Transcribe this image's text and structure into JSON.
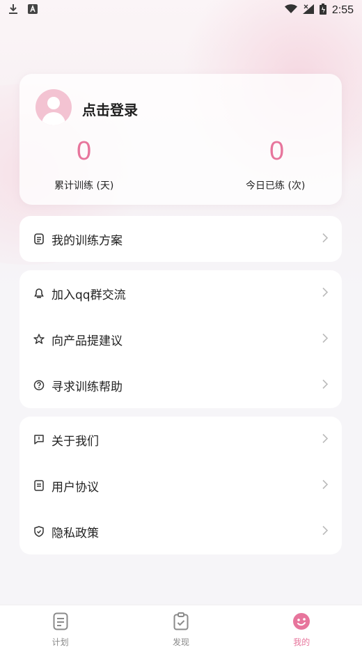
{
  "status_bar": {
    "time": "2:55",
    "icons": [
      "download-icon",
      "notification-a-icon",
      "wifi-icon",
      "signal-icon",
      "battery-icon"
    ]
  },
  "profile": {
    "login_text": "点击登录",
    "stats": [
      {
        "value": "0",
        "label": "累计训练 (天)"
      },
      {
        "value": "0",
        "label": "今日已练 (次)"
      }
    ]
  },
  "menu_groups": [
    {
      "items": [
        {
          "label": "我的训练方案",
          "icon": "list-icon"
        }
      ]
    },
    {
      "items": [
        {
          "label": "加入qq群交流",
          "icon": "qq-icon"
        },
        {
          "label": "向产品提建议",
          "icon": "suggest-icon"
        },
        {
          "label": "寻求训练帮助",
          "icon": "help-icon"
        }
      ]
    },
    {
      "items": [
        {
          "label": "关于我们",
          "icon": "chat-icon"
        },
        {
          "label": "用户协议",
          "icon": "document-icon"
        },
        {
          "label": "隐私政策",
          "icon": "shield-icon"
        }
      ]
    }
  ],
  "bottom_nav": {
    "tabs": [
      {
        "label": "计划",
        "icon": "plan-icon",
        "active": false
      },
      {
        "label": "发现",
        "icon": "clipboard-icon",
        "active": false
      },
      {
        "label": "我的",
        "icon": "smile-icon",
        "active": true
      }
    ]
  },
  "colors": {
    "accent": "#e7759c",
    "avatar_bg": "#f3c3d2"
  }
}
